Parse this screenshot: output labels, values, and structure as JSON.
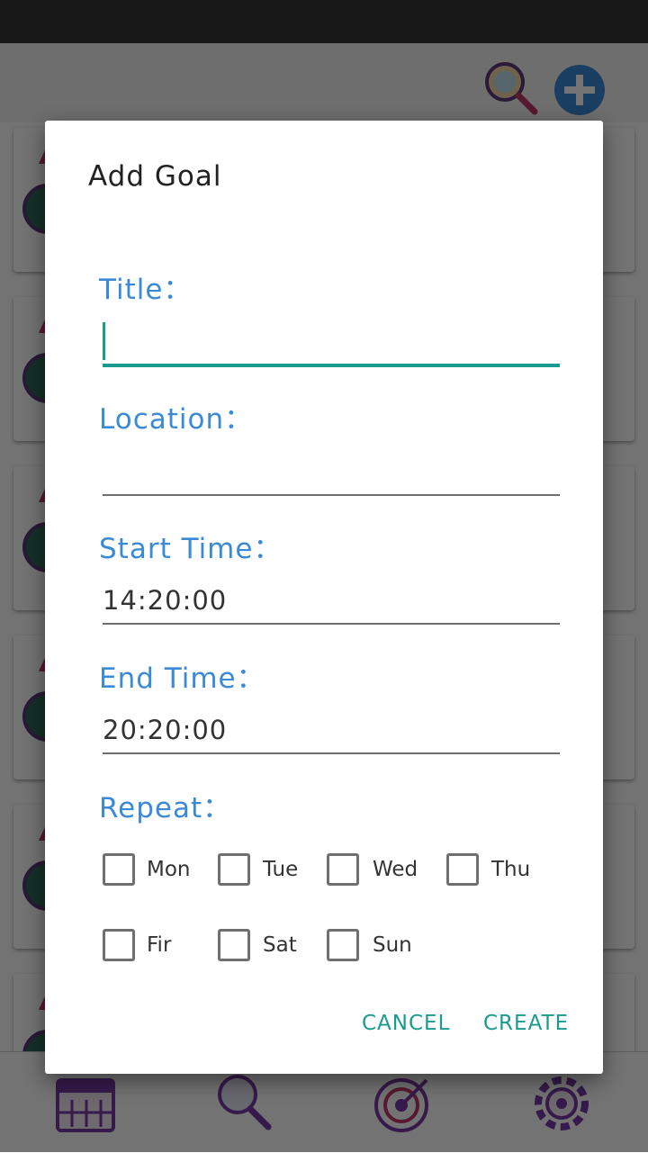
{
  "dialog": {
    "title": "Add Goal",
    "title_label": "Title：",
    "title_value": "",
    "location_label": "Location：",
    "location_value": "",
    "start_label": "Start Time：",
    "start_value": "14:20:00",
    "end_label": "End Time：",
    "end_value": "20:20:00",
    "repeat_label": "Repeat：",
    "days": [
      "Mon",
      "Tue",
      "Wed",
      "Thu",
      "Fir",
      "Sat",
      "Sun"
    ],
    "cancel": "CANCEL",
    "create": "CREATE"
  },
  "icons": {
    "top": [
      "search-icon",
      "add-icon"
    ],
    "card": "goal-icon",
    "bottom_nav": [
      "calendar-icon",
      "search-icon",
      "target-icon",
      "settings-icon"
    ]
  },
  "colors": {
    "accent": "#199b8e",
    "label_blue": "#3b8ad8",
    "status_bar": "#333333"
  }
}
